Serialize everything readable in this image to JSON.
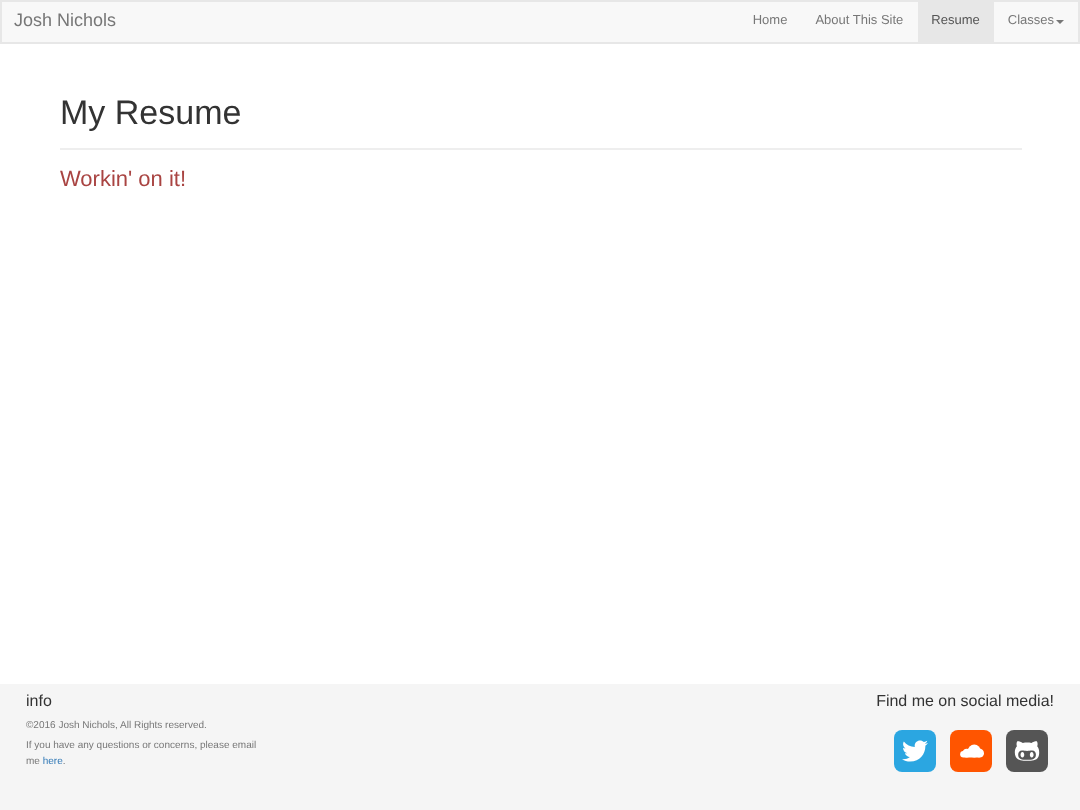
{
  "navbar": {
    "brand": "Josh Nichols",
    "items": [
      {
        "label": "Home",
        "selected": false,
        "kind": "link"
      },
      {
        "label": "About This Site",
        "selected": false,
        "kind": "link"
      },
      {
        "label": "Resume",
        "selected": true,
        "kind": "link"
      },
      {
        "label": "Classes",
        "selected": false,
        "kind": "dropdown"
      }
    ]
  },
  "main": {
    "title": "My Resume",
    "subtitle": "Workin' on it!"
  },
  "footer": {
    "info_title": "info",
    "copyright": "©2016 Josh Nichols, All Rights reserved.",
    "contact_before": "If you have any questions or concerns, please email me",
    "contact_link": "here",
    "contact_after": ".",
    "social_title": "Find me on social media!",
    "social": [
      {
        "kind": "twitter",
        "color": "#2ba6e1"
      },
      {
        "kind": "soundcloud",
        "color": "#ff5500"
      },
      {
        "kind": "github",
        "color": "#555555"
      }
    ]
  }
}
